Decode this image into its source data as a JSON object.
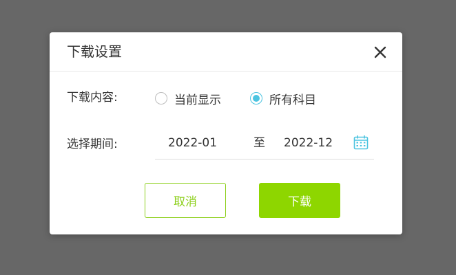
{
  "dialog": {
    "title": "下载设置",
    "close_icon": "close-icon"
  },
  "content_row": {
    "label": "下载内容:",
    "options": [
      {
        "label": "当前显示",
        "checked": false
      },
      {
        "label": "所有科目",
        "checked": true
      }
    ]
  },
  "period_row": {
    "label": "选择期间:",
    "start": "2022-01",
    "separator": "至",
    "end": "2022-12",
    "calendar_icon": "calendar-icon"
  },
  "buttons": {
    "cancel": "取消",
    "download": "下载"
  },
  "colors": {
    "accent_radio": "#4cc4e0",
    "accent_button": "#8ed600",
    "overlay": "#676767"
  }
}
